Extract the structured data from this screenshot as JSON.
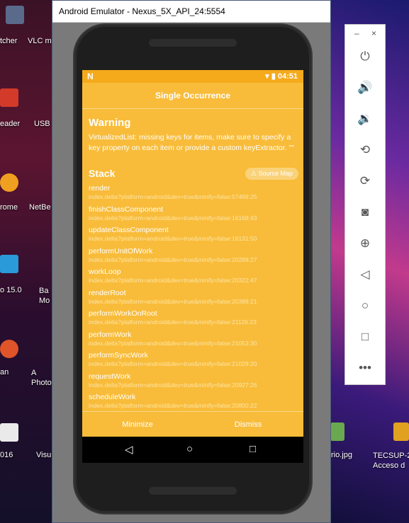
{
  "window": {
    "title": "Android Emulator - Nexus_5X_API_24:5554"
  },
  "desktop": {
    "left_labels": [
      "tcher",
      "eader",
      "rome",
      "o 15.0",
      "an",
      "016"
    ],
    "mid_labels": [
      "VLC m",
      "USB",
      "NetBe",
      "Ba Mo",
      "A Photo",
      "Visu"
    ],
    "right_labels": [
      "rio.jpg",
      "TECSUP-2 Acceso d"
    ]
  },
  "status_bar": {
    "carrier_icon": "N",
    "time": "04:51"
  },
  "app": {
    "title": "Single Occurrence",
    "warning_title": "Warning",
    "warning_message": "VirtualizedList: missing keys for items, make sure to specify a key property on each item or provide a custom keyExtractor. \"\"",
    "stack_title": "Stack",
    "source_map_label": "Source Map",
    "frames": [
      {
        "fn": "render",
        "loc": "index.delta?platform=android&dev=true&minify=false:57469:25"
      },
      {
        "fn": "finishClassComponent",
        "loc": "index.delta?platform=android&dev=true&minify=false:16168:43"
      },
      {
        "fn": "updateClassComponent",
        "loc": "index.delta?platform=android&dev=true&minify=false:16131:50"
      },
      {
        "fn": "performUnitOfWork",
        "loc": "index.delta?platform=android&dev=true&minify=false:20288:27"
      },
      {
        "fn": "workLoop",
        "loc": "index.delta?platform=android&dev=true&minify=false:20322:47"
      },
      {
        "fn": "renderRoot",
        "loc": "index.delta?platform=android&dev=true&minify=false:20388:21"
      },
      {
        "fn": "performWorkOnRoot",
        "loc": "index.delta?platform=android&dev=true&minify=false:21126:23"
      },
      {
        "fn": "performWork",
        "loc": "index.delta?platform=android&dev=true&minify=false:21053:30"
      },
      {
        "fn": "performSyncWork",
        "loc": "index.delta?platform=android&dev=true&minify=false:21029:20"
      },
      {
        "fn": "requestWork",
        "loc": "index.delta?platform=android&dev=true&minify=false:20927:26"
      },
      {
        "fn": "scheduleWork",
        "loc": "index.delta?platform=android&dev=true&minify=false:20800:22"
      }
    ],
    "minimize_label": "Minimize",
    "dismiss_label": "Dismiss"
  },
  "panel": {
    "minimize_glyph": "–",
    "close_glyph": "×"
  },
  "colors": {
    "accent": "#f8bc3a",
    "status_bar": "#f5aa1c"
  }
}
